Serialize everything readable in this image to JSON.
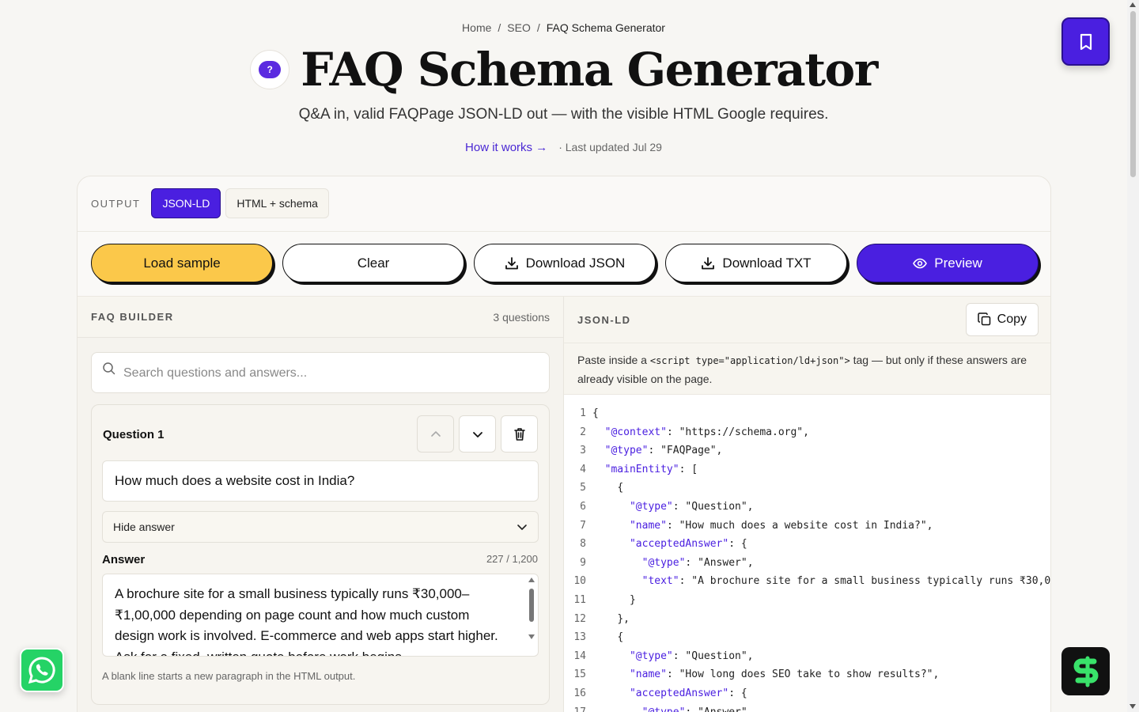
{
  "breadcrumb": {
    "home": "Home",
    "section": "SEO",
    "current": "FAQ Schema Generator",
    "sep": "/"
  },
  "header": {
    "logo_text": "?",
    "title": "FAQ Schema Generator",
    "subtitle": "Q&A in, valid FAQPage JSON-LD out — with the visible HTML Google requires.",
    "how_it_works": "How it works →",
    "last_updated": "· Last updated Jul 29"
  },
  "output": {
    "label": "OUTPUT",
    "tabs": [
      "JSON-LD",
      "HTML + schema"
    ],
    "active": "JSON-LD"
  },
  "actions": {
    "load_sample": "Load sample",
    "clear": "Clear",
    "download_json": "Download JSON",
    "download_txt": "Download TXT",
    "preview": "Preview"
  },
  "builder": {
    "label": "FAQ BUILDER",
    "count": "3 questions",
    "search_placeholder": "Search questions and answers...",
    "question": {
      "title": "Question 1",
      "text": "How much does a website cost in India?",
      "toggle": "Hide answer",
      "answer_label": "Answer",
      "char_count": "227 / 1,200",
      "answer": "A brochure site for a small business typically runs ₹30,000–₹1,00,000 depending on page count and how much custom design work is involved. E-commerce and web apps start higher. Ask for a fixed, written quote before work begins.",
      "hint": "A blank line starts a new paragraph in the HTML output."
    }
  },
  "jsonld": {
    "label": "JSON-LD",
    "copy": "Copy",
    "note_before": "Paste inside a ",
    "note_code": "<script type=\"application/ld+json\">",
    "note_after": " tag — but only if these answers are already visible on the page."
  },
  "code_lines": [
    {
      "n": "1",
      "indent": "",
      "key": "",
      "rest": "{"
    },
    {
      "n": "2",
      "indent": "  ",
      "key": "\"@context\"",
      "rest": ": \"https://schema.org\","
    },
    {
      "n": "3",
      "indent": "  ",
      "key": "\"@type\"",
      "rest": ": \"FAQPage\","
    },
    {
      "n": "4",
      "indent": "  ",
      "key": "\"mainEntity\"",
      "rest": ": ["
    },
    {
      "n": "5",
      "indent": "    ",
      "key": "",
      "rest": "{"
    },
    {
      "n": "6",
      "indent": "      ",
      "key": "\"@type\"",
      "rest": ": \"Question\","
    },
    {
      "n": "7",
      "indent": "      ",
      "key": "\"name\"",
      "rest": ": \"How much does a website cost in India?\","
    },
    {
      "n": "8",
      "indent": "      ",
      "key": "\"acceptedAnswer\"",
      "rest": ": {"
    },
    {
      "n": "9",
      "indent": "        ",
      "key": "\"@type\"",
      "rest": ": \"Answer\","
    },
    {
      "n": "10",
      "indent": "        ",
      "key": "\"text\"",
      "rest": ": \"A brochure site for a small business typically runs ₹30,0"
    },
    {
      "n": "11",
      "indent": "      ",
      "key": "",
      "rest": "}"
    },
    {
      "n": "12",
      "indent": "    ",
      "key": "",
      "rest": "},"
    },
    {
      "n": "13",
      "indent": "    ",
      "key": "",
      "rest": "{"
    },
    {
      "n": "14",
      "indent": "      ",
      "key": "\"@type\"",
      "rest": ": \"Question\","
    },
    {
      "n": "15",
      "indent": "      ",
      "key": "\"name\"",
      "rest": ": \"How long does SEO take to show results?\","
    },
    {
      "n": "16",
      "indent": "      ",
      "key": "\"acceptedAnswer\"",
      "rest": ": {"
    },
    {
      "n": "17",
      "indent": "        ",
      "key": "\"@type\"",
      "rest": ": \"Answer\","
    }
  ],
  "colors": {
    "accent": "#4a1fe0",
    "yellow": "#fbc84a",
    "whatsapp": "#25d366",
    "brand_green": "#39e26a"
  }
}
